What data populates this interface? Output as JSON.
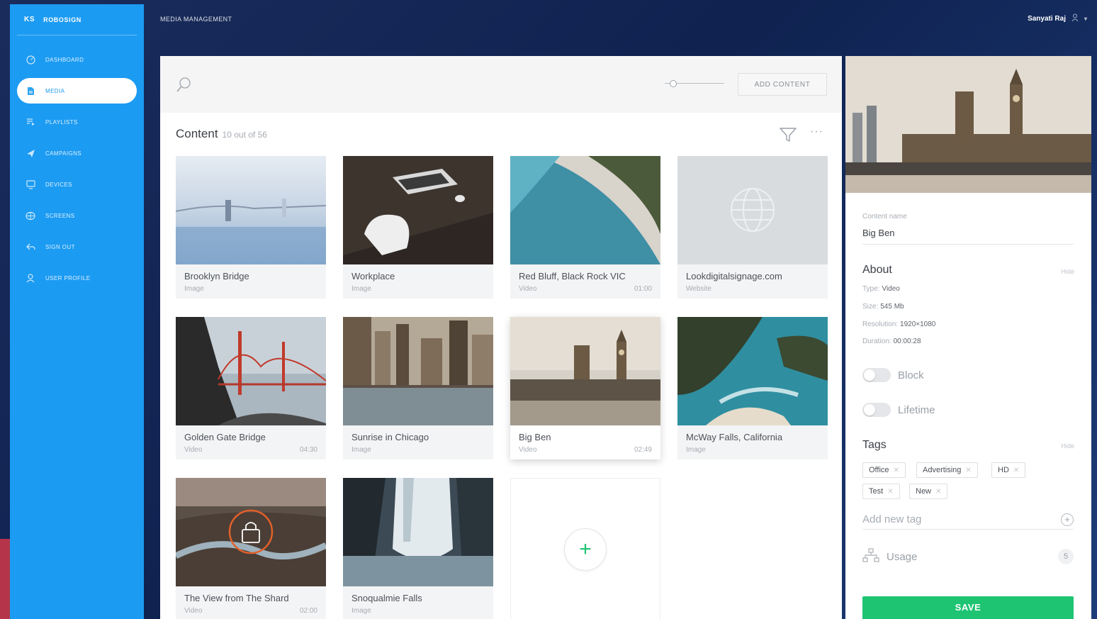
{
  "brand": {
    "mark": "KS",
    "name": "ROBOSIGN"
  },
  "sidebar": {
    "items": [
      {
        "label": "DASHBOARD",
        "icon": "dashboard-icon"
      },
      {
        "label": "MEDIA",
        "icon": "document-icon",
        "active": true
      },
      {
        "label": "PLAYLISTS",
        "icon": "playlist-icon"
      },
      {
        "label": "CAMPAIGNS",
        "icon": "send-icon"
      },
      {
        "label": "DEVICES",
        "icon": "monitor-icon"
      },
      {
        "label": "SCREENS",
        "icon": "globe-icon"
      },
      {
        "label": "SIGN OUT",
        "icon": "back-arrow-icon"
      },
      {
        "label": "USER PROFILE",
        "icon": "user-icon"
      }
    ]
  },
  "header": {
    "title": "MEDIA MANAGEMENT",
    "user_name": "Sanyati Raj"
  },
  "toolbar": {
    "add_content_label": "ADD CONTENT",
    "zoom_level": 0.1
  },
  "content": {
    "title": "Content",
    "count_text": "10 out of 56"
  },
  "cards": [
    {
      "name": "Brooklyn Bridge",
      "type": "Image",
      "duration": ""
    },
    {
      "name": "Workplace",
      "type": "Image",
      "duration": ""
    },
    {
      "name": "Red Bluff, Black Rock VIC",
      "type": "Video",
      "duration": "01:00"
    },
    {
      "name": "Lookdigitalsignage.com",
      "type": "Website",
      "duration": ""
    },
    {
      "name": "Golden Gate Bridge",
      "type": "Video",
      "duration": "04:30"
    },
    {
      "name": "Sunrise in Chicago",
      "type": "Image",
      "duration": ""
    },
    {
      "name": "Big Ben",
      "type": "Video",
      "duration": "02:49"
    },
    {
      "name": "McWay Falls, California",
      "type": "Image",
      "duration": ""
    },
    {
      "name": "The View from The Shard",
      "type": "Video",
      "duration": "02:00"
    },
    {
      "name": "Snoqualmie Falls",
      "type": "Image",
      "duration": ""
    }
  ],
  "detail": {
    "content_name_label": "Content name",
    "content_name": "Big Ben",
    "about_title": "About",
    "hide_label": "Hide",
    "meta": [
      {
        "label": "Type:",
        "value": "Video"
      },
      {
        "label": "Size:",
        "value": "545 Mb"
      },
      {
        "label": "Resolution:",
        "value": "1920×1080"
      },
      {
        "label": "Duration:",
        "value": "00:00:28"
      }
    ],
    "block_label": "Block",
    "lifetime_label": "Lifetime",
    "tags_title": "Tags",
    "tags": [
      "Office",
      "Advertising",
      "HD",
      "Test",
      "New"
    ],
    "add_tag_placeholder": "Add new tag",
    "usage_label": "Usage",
    "usage_count": "5",
    "save_label": "SAVE"
  },
  "colors": {
    "sidebar": "#1c9bf2",
    "accent_green": "#1fc473",
    "header_bg": "#13295a"
  }
}
